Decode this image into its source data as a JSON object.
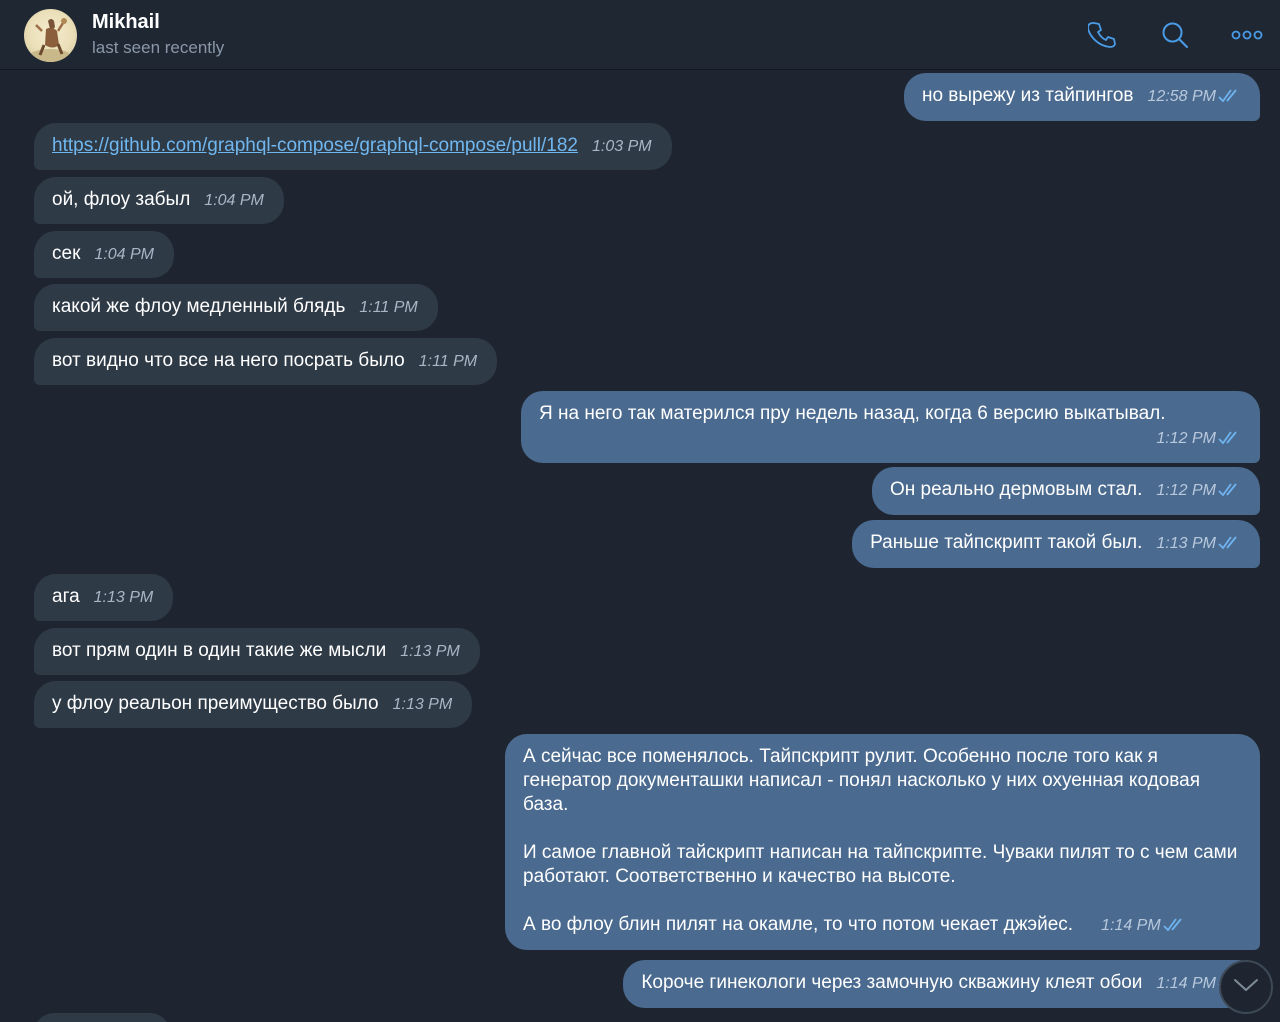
{
  "header": {
    "name": "Mikhail",
    "status": "last seen recently",
    "icons": [
      "phone-icon",
      "search-icon",
      "more-icon"
    ]
  },
  "messages": [
    {
      "dir": "out",
      "text": "но вырежу из тайпингов",
      "time": "12:58 PM",
      "read": true
    },
    {
      "dir": "in",
      "text": "https://github.com/graphql-compose/graphql-compose/pull/182",
      "time": "1:03 PM",
      "link": true
    },
    {
      "dir": "in",
      "text": "ой, флоу забыл",
      "time": "1:04 PM"
    },
    {
      "dir": "in",
      "text": "сек",
      "time": "1:04 PM"
    },
    {
      "dir": "in",
      "text": "какой же флоу медленный блядь",
      "time": "1:11 PM"
    },
    {
      "dir": "in",
      "text": "вот видно что все на него посрать было",
      "time": "1:11 PM"
    },
    {
      "dir": "out",
      "text": "Я на него так матерился пру недель назад, когда 6 версию выкатывал.",
      "time": "1:12 PM",
      "read": true
    },
    {
      "dir": "out",
      "text": "Он реально дермовым стал.",
      "time": "1:12 PM",
      "read": true
    },
    {
      "dir": "out",
      "text": "Раньше тайпскрипт такой был.",
      "time": "1:13 PM",
      "read": true
    },
    {
      "dir": "in",
      "text": "ага",
      "time": "1:13 PM"
    },
    {
      "dir": "in",
      "text": "вот прям один в один такие же мысли",
      "time": "1:13 PM"
    },
    {
      "dir": "in",
      "text": "у флоу реальон преимущество было",
      "time": "1:13 PM"
    },
    {
      "dir": "out",
      "paragraphs": [
        "А сейчас все поменялось. Тайпскрипт рулит. Особенно после того как я генератор документашки написал - понял насколько у них охуенная кодовая база.",
        "И самое главной тайскрипт написан на тайпскрипте. Чуваки пилят то с чем сами работают. Соответственно и качество на высоте.",
        "А во флоу блин пилят на окамле, то что потом чекает джэйес."
      ],
      "time": "1:14 PM",
      "read": true
    },
    {
      "dir": "out",
      "text": "Короче гинекологи через замочную скважину клеят обои",
      "time": "1:14 PM",
      "read": true
    }
  ],
  "colors": {
    "background": "#1e2530",
    "incoming_bubble": "#2f3a47",
    "outgoing_bubble": "#4a6a8f",
    "link": "#70b7ef",
    "accent": "#4a9be6"
  }
}
